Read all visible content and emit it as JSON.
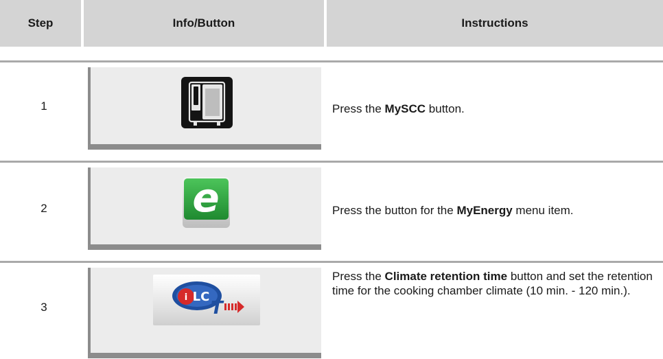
{
  "table": {
    "headers": {
      "step": "Step",
      "info": "Info/Button",
      "instructions": "Instructions"
    },
    "rows": [
      {
        "step": "1",
        "icon": "myscc-oven-icon",
        "pre": "Press the ",
        "bold": "MySCC",
        "post": " button."
      },
      {
        "step": "2",
        "icon": "myenergy-e-icon",
        "pre": "Press the button for the ",
        "bold": "MyEnergy",
        "post": " menu item."
      },
      {
        "step": "3",
        "icon": "climate-retention-ilc-icon",
        "pre": "Press the ",
        "bold": "Climate retention time",
        "post": " button and set the retention time for the cooking chamber climate (10 min. - 120 min.)."
      }
    ]
  },
  "colors": {
    "header_bg": "#d4d4d4",
    "panel_bg": "#ececec",
    "panel_border": "#8c8c8c",
    "energy_green": "#2fa341",
    "ilc_blue": "#1f4fa0",
    "ilc_red": "#d62a2a"
  }
}
